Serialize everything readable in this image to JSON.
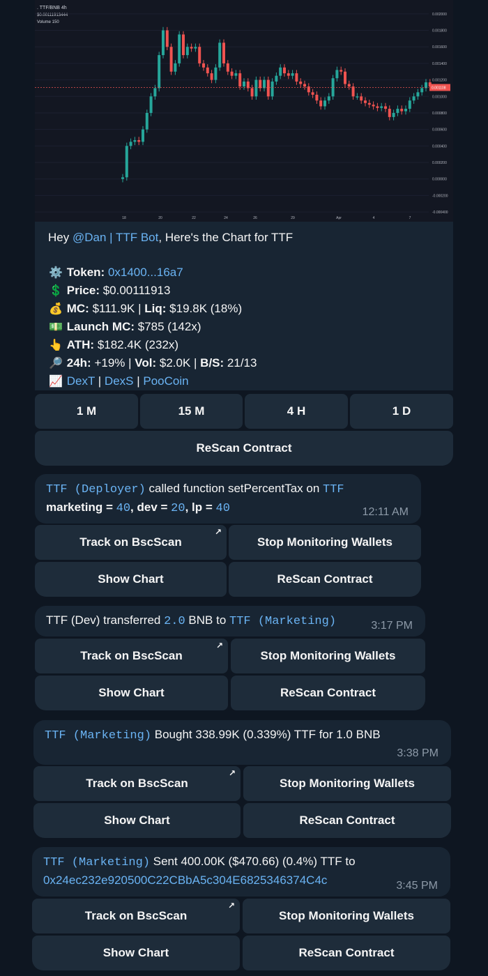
{
  "chart_image": {
    "pair_label": ". TTF/BNB 4h",
    "price_label": "$0.00111913444",
    "volume_label": "Volume 150",
    "current_price_tag": "0.001108",
    "y_ticks": [
      "0.002000",
      "0.001800",
      "0.001600",
      "0.001400",
      "0.001200",
      "0.001000",
      "0.000800",
      "0.000600",
      "0.000400",
      "0.000200",
      "0.000000",
      "-0.000200",
      "-0.000400"
    ],
    "x_ticks": [
      "18",
      "20",
      "22",
      "24",
      "26",
      "29",
      "Apr",
      "4",
      "7"
    ],
    "colors": {
      "up": "#26a69a",
      "down": "#ef5350",
      "bg": "#131722"
    },
    "closes": [
      2e-05,
      0.0004,
      0.00045,
      0.00047,
      0.00045,
      0.0006,
      0.0008,
      0.001,
      0.0011,
      0.0015,
      0.0018,
      0.0016,
      0.0013,
      0.0014,
      0.00175,
      0.0015,
      0.0016,
      0.00158,
      0.0016,
      0.0014,
      0.00135,
      0.00128,
      0.0012,
      0.00135,
      0.00165,
      0.0014,
      0.0013,
      0.00125,
      0.00128,
      0.00112,
      0.00118,
      0.0011,
      0.001,
      0.0012,
      0.0011,
      0.0012,
      0.001,
      0.00118,
      0.00125,
      0.00135,
      0.00128,
      0.00125,
      0.00128,
      0.00118,
      0.00115,
      0.00112,
      0.00105,
      0.00102,
      0.00095,
      0.00088,
      0.00095,
      0.001,
      0.00122,
      0.00132,
      0.0013,
      0.00115,
      0.00112,
      0.001,
      0.001,
      0.00095,
      0.00092,
      0.0009,
      0.00088,
      0.00086,
      0.00088,
      0.00085,
      0.00075,
      0.0008,
      0.00085,
      0.00082,
      0.00085,
      0.00095,
      0.001,
      0.00105,
      0.0011,
      0.00117,
      0.00112
    ]
  },
  "header": {
    "greeting_pre": "Hey ",
    "user_link": "@Dan | TTF Bot",
    "greeting_post": ", Here's the Chart for TTF"
  },
  "token": {
    "token_label": "Token:",
    "token_value": "0x1400...16a7",
    "price_label": "Price:",
    "price_value": "$0.00111913",
    "mc_label": "MC:",
    "mc_value": "$111.9K",
    "sep1": " | ",
    "liq_label": "Liq:",
    "liq_value": "$19.8K (18%)",
    "launch_label": "Launch MC:",
    "launch_value": "$785 (142x)",
    "ath_label": "ATH:",
    "ath_value": "$182.4K (232x)",
    "h24_label": "24h:",
    "h24_value": "+19%",
    "vol_label": "Vol:",
    "vol_value": "$2.0K",
    "bs_label": "B/S:",
    "bs_value": "21/13",
    "links": [
      "DexT",
      "DexS",
      "PooCoin"
    ],
    "link_sep": " | ",
    "emojis": [
      "⚙️",
      "💲",
      "💰",
      "💵",
      "👆",
      "🔎",
      "📈"
    ]
  },
  "chart_keyboard": {
    "timeframes": [
      "1 M",
      "15 M",
      "4 H",
      "1 D"
    ],
    "rescan": "ReScan Contract"
  },
  "alerts": [
    {
      "line1_code1": "TTF (Deployer)",
      "line1_text": " called function setPercentTax on ",
      "line1_code2": "TTF",
      "line2_k1": "marketing = ",
      "line2_v1": "40",
      "line2_k2": ", dev = ",
      "line2_v2": "20",
      "line2_k3": ", lp = ",
      "line2_v3": "40",
      "time": "12:11 AM"
    },
    {
      "text1": "TTF (Dev) transferred ",
      "amount": "2.0",
      "text2": " BNB to ",
      "code": "TTF (Marketing)",
      "time": "3:17 PM"
    },
    {
      "code": "TTF (Marketing)",
      "text": " Bought 338.99K (0.339%) TTF for 1.0 BNB",
      "time": "3:38 PM"
    },
    {
      "code": "TTF (Marketing)",
      "text": " Sent 400.00K ($470.66) (0.4%) TTF to",
      "address": "0x24ec232e920500C22CBbA5c304E6825346374C4c",
      "time": "3:45 PM"
    }
  ],
  "alert_keyboard": {
    "track": "Track on BscScan",
    "stop": "Stop Monitoring Wallets",
    "show_chart": "Show Chart",
    "rescan": "ReScan Contract",
    "external_icon": "↗"
  }
}
